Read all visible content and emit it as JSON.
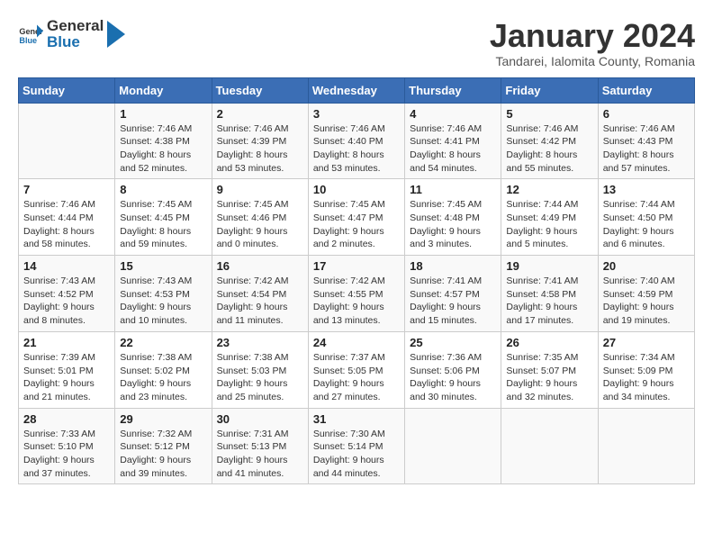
{
  "logo": {
    "general": "General",
    "blue": "Blue"
  },
  "title": "January 2024",
  "subtitle": "Tandarei, Ialomita County, Romania",
  "days_of_week": [
    "Sunday",
    "Monday",
    "Tuesday",
    "Wednesday",
    "Thursday",
    "Friday",
    "Saturday"
  ],
  "weeks": [
    [
      {
        "day": "",
        "info": ""
      },
      {
        "day": "1",
        "info": "Sunrise: 7:46 AM\nSunset: 4:38 PM\nDaylight: 8 hours\nand 52 minutes."
      },
      {
        "day": "2",
        "info": "Sunrise: 7:46 AM\nSunset: 4:39 PM\nDaylight: 8 hours\nand 53 minutes."
      },
      {
        "day": "3",
        "info": "Sunrise: 7:46 AM\nSunset: 4:40 PM\nDaylight: 8 hours\nand 53 minutes."
      },
      {
        "day": "4",
        "info": "Sunrise: 7:46 AM\nSunset: 4:41 PM\nDaylight: 8 hours\nand 54 minutes."
      },
      {
        "day": "5",
        "info": "Sunrise: 7:46 AM\nSunset: 4:42 PM\nDaylight: 8 hours\nand 55 minutes."
      },
      {
        "day": "6",
        "info": "Sunrise: 7:46 AM\nSunset: 4:43 PM\nDaylight: 8 hours\nand 57 minutes."
      }
    ],
    [
      {
        "day": "7",
        "info": "Sunrise: 7:46 AM\nSunset: 4:44 PM\nDaylight: 8 hours\nand 58 minutes."
      },
      {
        "day": "8",
        "info": "Sunrise: 7:45 AM\nSunset: 4:45 PM\nDaylight: 8 hours\nand 59 minutes."
      },
      {
        "day": "9",
        "info": "Sunrise: 7:45 AM\nSunset: 4:46 PM\nDaylight: 9 hours\nand 0 minutes."
      },
      {
        "day": "10",
        "info": "Sunrise: 7:45 AM\nSunset: 4:47 PM\nDaylight: 9 hours\nand 2 minutes."
      },
      {
        "day": "11",
        "info": "Sunrise: 7:45 AM\nSunset: 4:48 PM\nDaylight: 9 hours\nand 3 minutes."
      },
      {
        "day": "12",
        "info": "Sunrise: 7:44 AM\nSunset: 4:49 PM\nDaylight: 9 hours\nand 5 minutes."
      },
      {
        "day": "13",
        "info": "Sunrise: 7:44 AM\nSunset: 4:50 PM\nDaylight: 9 hours\nand 6 minutes."
      }
    ],
    [
      {
        "day": "14",
        "info": "Sunrise: 7:43 AM\nSunset: 4:52 PM\nDaylight: 9 hours\nand 8 minutes."
      },
      {
        "day": "15",
        "info": "Sunrise: 7:43 AM\nSunset: 4:53 PM\nDaylight: 9 hours\nand 10 minutes."
      },
      {
        "day": "16",
        "info": "Sunrise: 7:42 AM\nSunset: 4:54 PM\nDaylight: 9 hours\nand 11 minutes."
      },
      {
        "day": "17",
        "info": "Sunrise: 7:42 AM\nSunset: 4:55 PM\nDaylight: 9 hours\nand 13 minutes."
      },
      {
        "day": "18",
        "info": "Sunrise: 7:41 AM\nSunset: 4:57 PM\nDaylight: 9 hours\nand 15 minutes."
      },
      {
        "day": "19",
        "info": "Sunrise: 7:41 AM\nSunset: 4:58 PM\nDaylight: 9 hours\nand 17 minutes."
      },
      {
        "day": "20",
        "info": "Sunrise: 7:40 AM\nSunset: 4:59 PM\nDaylight: 9 hours\nand 19 minutes."
      }
    ],
    [
      {
        "day": "21",
        "info": "Sunrise: 7:39 AM\nSunset: 5:01 PM\nDaylight: 9 hours\nand 21 minutes."
      },
      {
        "day": "22",
        "info": "Sunrise: 7:38 AM\nSunset: 5:02 PM\nDaylight: 9 hours\nand 23 minutes."
      },
      {
        "day": "23",
        "info": "Sunrise: 7:38 AM\nSunset: 5:03 PM\nDaylight: 9 hours\nand 25 minutes."
      },
      {
        "day": "24",
        "info": "Sunrise: 7:37 AM\nSunset: 5:05 PM\nDaylight: 9 hours\nand 27 minutes."
      },
      {
        "day": "25",
        "info": "Sunrise: 7:36 AM\nSunset: 5:06 PM\nDaylight: 9 hours\nand 30 minutes."
      },
      {
        "day": "26",
        "info": "Sunrise: 7:35 AM\nSunset: 5:07 PM\nDaylight: 9 hours\nand 32 minutes."
      },
      {
        "day": "27",
        "info": "Sunrise: 7:34 AM\nSunset: 5:09 PM\nDaylight: 9 hours\nand 34 minutes."
      }
    ],
    [
      {
        "day": "28",
        "info": "Sunrise: 7:33 AM\nSunset: 5:10 PM\nDaylight: 9 hours\nand 37 minutes."
      },
      {
        "day": "29",
        "info": "Sunrise: 7:32 AM\nSunset: 5:12 PM\nDaylight: 9 hours\nand 39 minutes."
      },
      {
        "day": "30",
        "info": "Sunrise: 7:31 AM\nSunset: 5:13 PM\nDaylight: 9 hours\nand 41 minutes."
      },
      {
        "day": "31",
        "info": "Sunrise: 7:30 AM\nSunset: 5:14 PM\nDaylight: 9 hours\nand 44 minutes."
      },
      {
        "day": "",
        "info": ""
      },
      {
        "day": "",
        "info": ""
      },
      {
        "day": "",
        "info": ""
      }
    ]
  ]
}
